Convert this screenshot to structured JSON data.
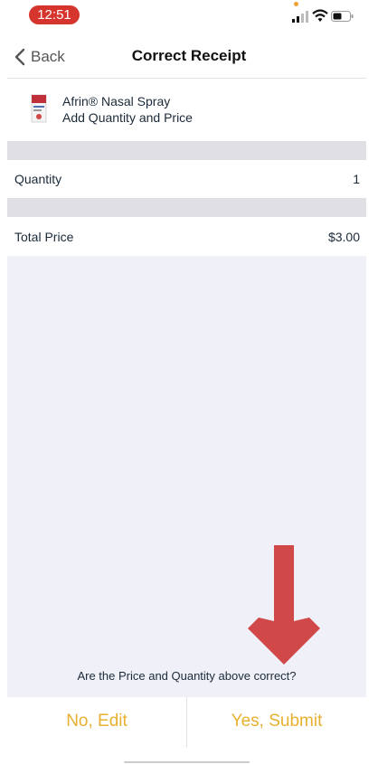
{
  "status_bar": {
    "time": "12:51",
    "icons": [
      "signal-icon",
      "wifi-icon",
      "battery-icon"
    ],
    "accent": "#d6352d"
  },
  "nav": {
    "back_label": "Back",
    "title": "Correct Receipt"
  },
  "product": {
    "name": "Afrin® Nasal Spray",
    "subtitle": "Add Quantity and Price",
    "image_icon": "product-thumbnail"
  },
  "rows": {
    "quantity_label": "Quantity",
    "quantity_value": "1",
    "total_label": "Total Price",
    "total_value": "$3.00"
  },
  "confirm": {
    "question": "Are the Price and Quantity above correct?",
    "no_label": "No, Edit",
    "yes_label": "Yes, Submit",
    "button_color": "#e8b030",
    "arrow_color": "#d04848"
  }
}
